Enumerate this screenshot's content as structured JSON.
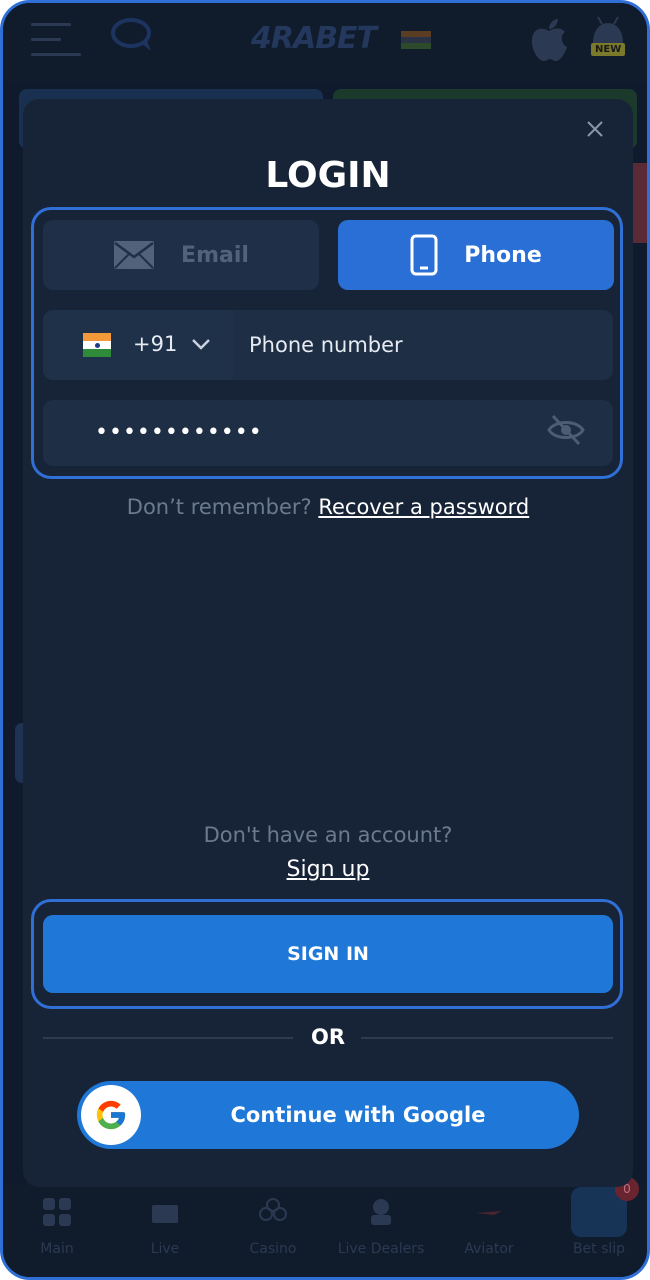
{
  "header": {
    "brand": "4RABET",
    "new_badge": "NEW"
  },
  "modal": {
    "title": "LOGIN",
    "tabs": [
      {
        "label": "Email",
        "icon": "envelope-icon",
        "active": false
      },
      {
        "label": "Phone",
        "icon": "phone-icon",
        "active": true
      }
    ],
    "country_code": "+91",
    "country_flag": "india-flag-icon",
    "phone_placeholder": "Phone number",
    "password_masked": "••••••••••••",
    "remember_prefix": "Don’t remember?",
    "recover_link": "Recover a password",
    "no_account": "Don't have an account?",
    "signup_link": "Sign up",
    "signin_label": "SIGN IN",
    "or_label": "OR",
    "google_label": "Continue with Google"
  },
  "bottom_nav": {
    "items": [
      {
        "label": "Main"
      },
      {
        "label": "Live"
      },
      {
        "label": "Casino"
      },
      {
        "label": "Live Dealers"
      },
      {
        "label": "Aviator"
      },
      {
        "label": "Bet slip"
      }
    ],
    "bet_count": "0"
  },
  "colors": {
    "accent": "#2f6fd6",
    "button": "#1f78d8",
    "modal_bg": "#172437"
  }
}
